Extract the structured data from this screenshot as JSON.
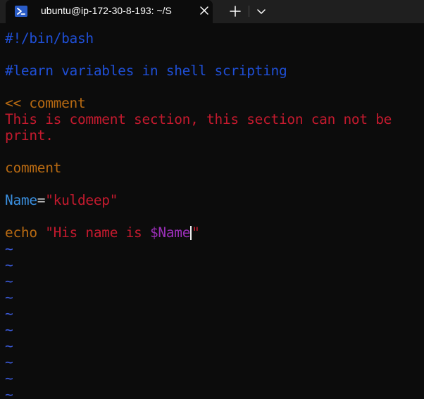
{
  "window": {
    "tab": {
      "title": "ubuntu@ip-172-30-8-193: ~/S",
      "icon": "powershell-icon"
    },
    "colors": {
      "tab_bar": "#1f1f1f",
      "terminal_bg": "#0c0c0c",
      "shebang": "#1f4fd6",
      "keyword": "#b86a12",
      "string": "#c41a2e",
      "identifier": "#3a8fdf",
      "variable": "#9a2fb8",
      "tilde": "#3b5bdb"
    }
  },
  "editor": {
    "shebang": "#!/bin/bash",
    "comment_line": "#learn variables in shell scripting",
    "heredoc_start": "<< comment",
    "heredoc_body_1": "This is comment section, this section can not be",
    "heredoc_body_2": "print.",
    "heredoc_end": "comment",
    "assign_name": "Name",
    "assign_eq": "=",
    "assign_value": "\"kuldeep\"",
    "echo_cmd": "echo",
    "echo_string": "\"His name is ",
    "echo_var": "$Name",
    "echo_quote": "\"",
    "tilde": "~"
  }
}
